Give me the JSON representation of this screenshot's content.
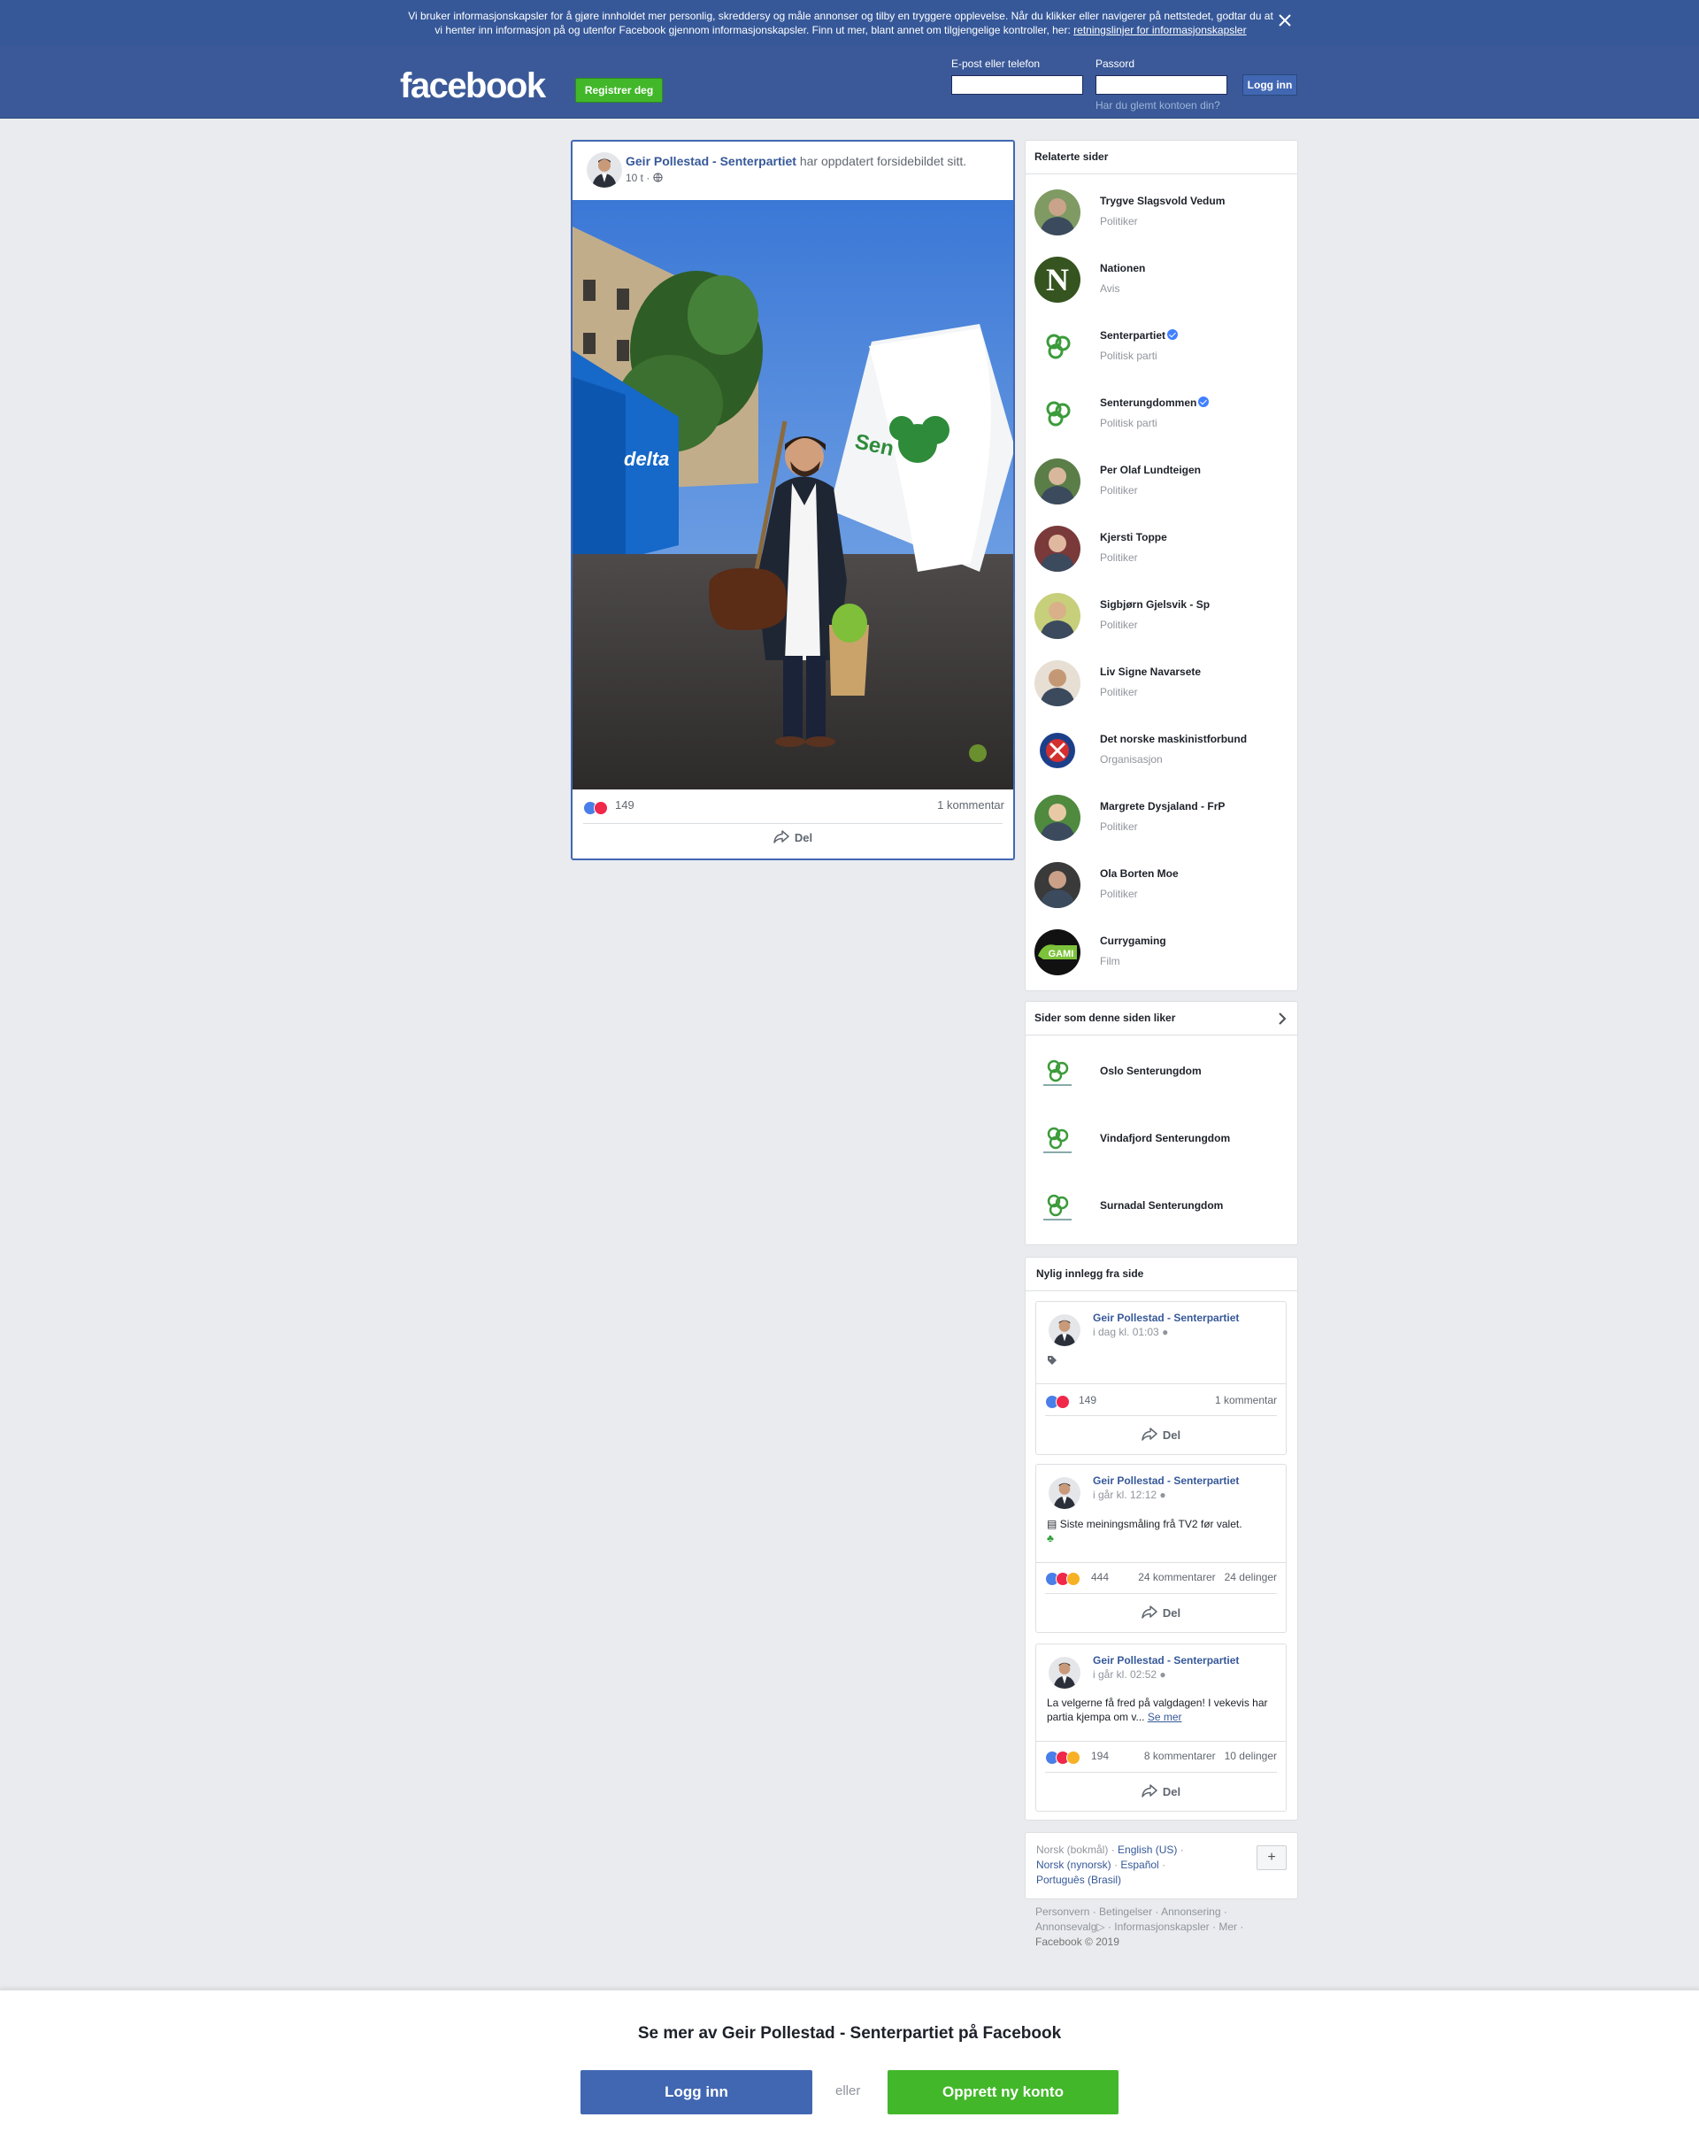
{
  "cookie_banner": {
    "text_line1": "Vi bruker informasjonskapsler for å gjøre innholdet mer personlig, skreddersy og måle annonser og tilby en tryggere opplevelse. Når du klikker eller navigerer på nettstedet, godtar du at",
    "text_line2_prefix": "vi henter inn informasjon på og utenfor Facebook gjennom informasjonskapsler. Finn ut mer, blant annet om tilgjengelige kontroller, her: ",
    "link": "retningslinjer for informasjonskapsler"
  },
  "header": {
    "logo": "facebook",
    "register_label": "Registrer deg",
    "email_label": "E-post eller telefon",
    "password_label": "Passord",
    "login_label": "Logg inn",
    "forgot_label": "Har du glemt kontoen din?"
  },
  "post": {
    "author": "Geir Pollestad - Senterpartiet",
    "action": " har oppdatert forsidebildet sitt.",
    "time": "10 t",
    "reaction_count": "149",
    "comments": "1 kommentar",
    "share_label": "Del"
  },
  "related": {
    "title": "Relaterte sider",
    "items": [
      {
        "name": "Trygve Slagsvold Vedum",
        "category": "Politiker",
        "verified": false
      },
      {
        "name": "Nationen",
        "category": "Avis",
        "verified": false
      },
      {
        "name": "Senterpartiet",
        "category": "Politisk parti",
        "verified": true
      },
      {
        "name": "Senterungdommen",
        "category": "Politisk parti",
        "verified": true
      },
      {
        "name": "Per Olaf Lundteigen",
        "category": "Politiker",
        "verified": false
      },
      {
        "name": "Kjersti Toppe",
        "category": "Politiker",
        "verified": false
      },
      {
        "name": "Sigbjørn Gjelsvik - Sp",
        "category": "Politiker",
        "verified": false
      },
      {
        "name": "Liv Signe Navarsete",
        "category": "Politiker",
        "verified": false
      },
      {
        "name": "Det norske maskinistforbund",
        "category": "Organisasjon",
        "verified": false
      },
      {
        "name": "Margrete Dysjaland - FrP",
        "category": "Politiker",
        "verified": false
      },
      {
        "name": "Ola Borten Moe",
        "category": "Politiker",
        "verified": false
      },
      {
        "name": "Currygaming",
        "category": "Film",
        "verified": false
      }
    ]
  },
  "likes": {
    "title": "Sider som denne siden liker",
    "items": [
      "Oslo Senterungdom",
      "Vindafjord Senterungdom",
      "Surnadal Senterungdom"
    ]
  },
  "recent": {
    "title": "Nylig innlegg fra side",
    "posts": [
      {
        "author": "Geir Pollestad - Senterpartiet",
        "time": "i dag kl. 01:03",
        "text": "",
        "reactions": "149",
        "right": "1 kommentar",
        "share": "Del"
      },
      {
        "author": "Geir Pollestad - Senterpartiet",
        "time": "i går kl. 12:12",
        "text": "Siste meiningsmåling frå TV2 før valet.",
        "reactions": "444",
        "right": "24 kommentarer   24 delinger",
        "share": "Del"
      },
      {
        "author": "Geir Pollestad - Senterpartiet",
        "time": "i går kl. 02:52",
        "text": "La velgerne få fred på valgdagen! I vekevis har partia kjempa om v...",
        "see_more": "Se mer",
        "reactions": "194",
        "right": "8 kommentarer   10 delinger",
        "share": "Del"
      }
    ]
  },
  "languages": {
    "current": "Norsk (bokmål)",
    "others": [
      "English (US)",
      "Norsk (nynorsk)",
      "Español",
      "Português (Brasil)"
    ],
    "plus": "+"
  },
  "footer": {
    "links": [
      "Personvern",
      "Betingelser",
      "Annonsering",
      "Annonsevalg",
      "Informasjonskapsler",
      "Mer"
    ],
    "copyright": "Facebook © 2019"
  },
  "bottom": {
    "title": "Se mer av Geir Pollestad - Senterpartiet på Facebook",
    "login": "Logg inn",
    "or": "eller",
    "create": "Opprett ny konto"
  },
  "colors": {
    "brand_blue": "#3b5998",
    "link_blue": "#365899",
    "green": "#42b72a",
    "background": "#e9ebee"
  }
}
